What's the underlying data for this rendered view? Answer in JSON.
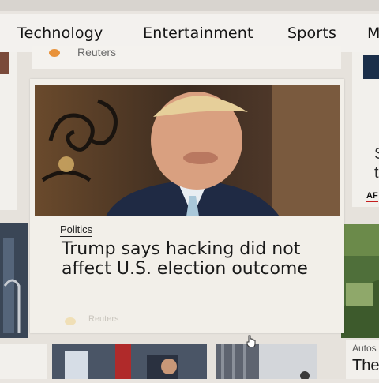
{
  "nav": {
    "items": [
      {
        "label": "Technology"
      },
      {
        "label": "Entertainment"
      },
      {
        "label": "Sports"
      },
      {
        "label": "M"
      }
    ]
  },
  "top_card": {
    "source": "Reuters",
    "icon": "reuters-logo-icon"
  },
  "main_card": {
    "image_icon": "news-photo",
    "category": "Politics",
    "headline": "Trump says hacking did not affect U.S. election outcome",
    "source": "Reuters",
    "source_icon": "reuters-logo-icon"
  },
  "right_column": {
    "partial_letters": [
      "S",
      "t"
    ],
    "badge": "AF"
  },
  "bottom_right": {
    "category": "Autos",
    "headline_partial": "The"
  },
  "colors": {
    "accent_orange": "#e8923a",
    "badge_red": "#c41e1e",
    "nav_bg": "#f3f1ee",
    "card_bg": "#f2efe9"
  }
}
